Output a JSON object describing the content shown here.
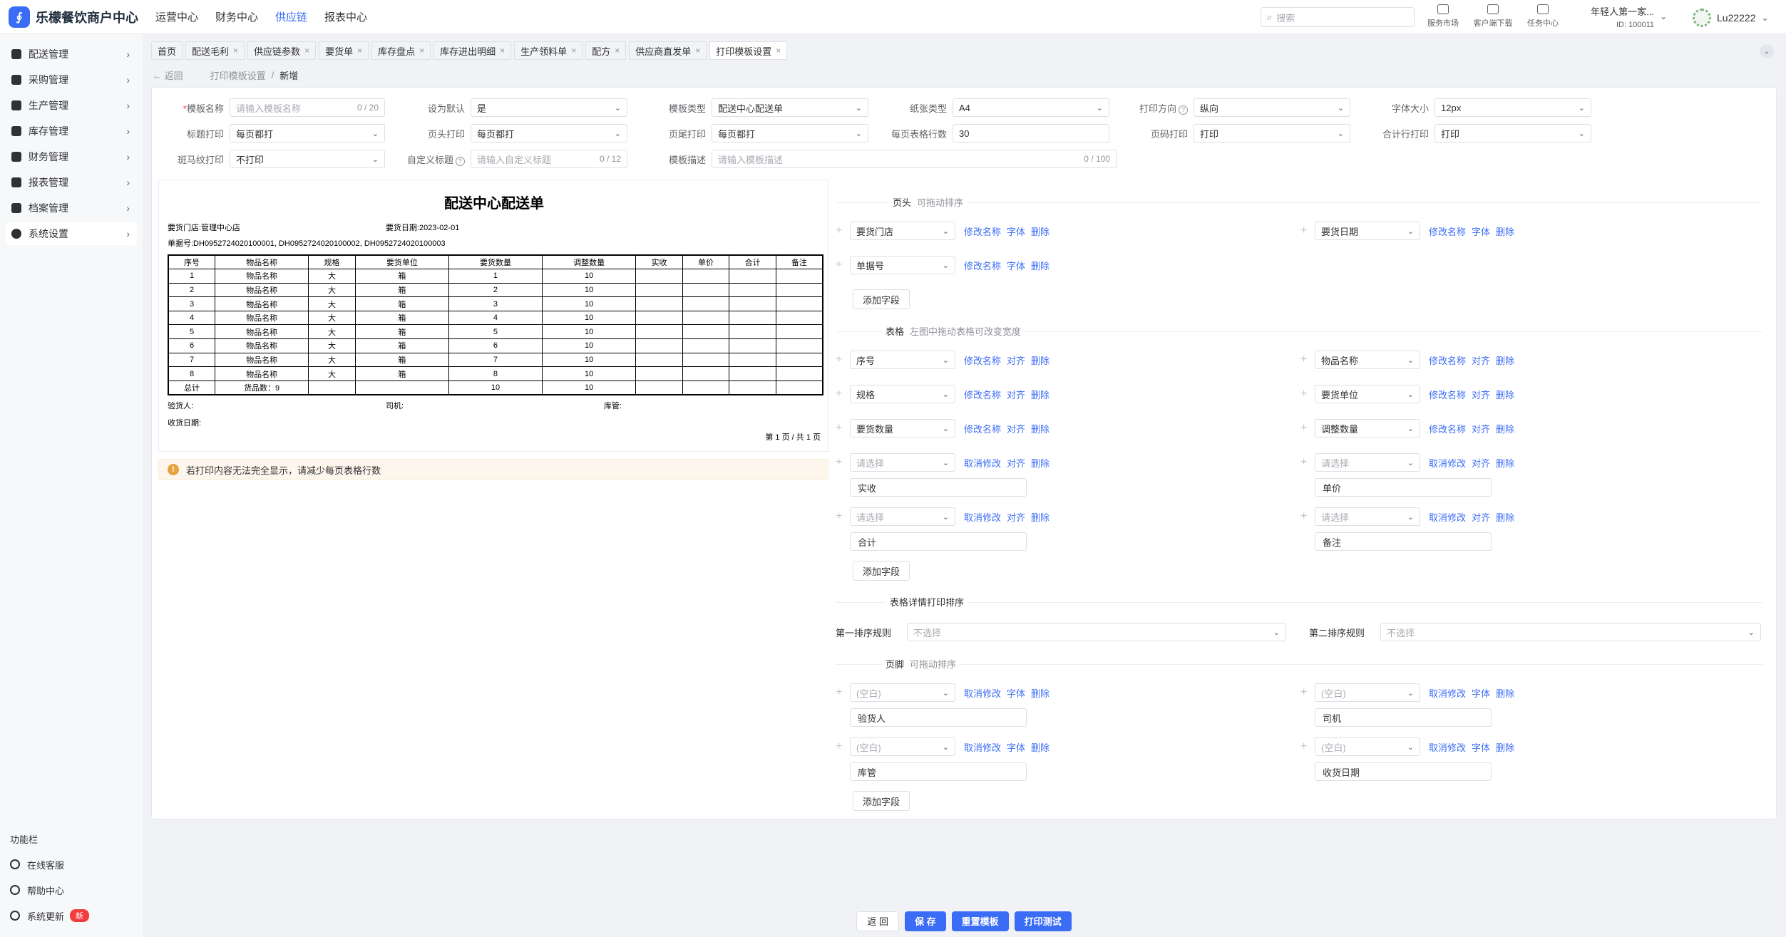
{
  "app": {
    "title": "乐檬餐饮商户中心",
    "logo_glyph": "∮"
  },
  "topnav": [
    "运营中心",
    "财务中心",
    "供应链",
    "报表中心"
  ],
  "topnav_active": "供应链",
  "search_placeholder": "搜索",
  "tools": [
    "服务市场",
    "客户端下载",
    "任务中心"
  ],
  "account": {
    "name": "年轻人第一家...",
    "id": "ID: 100011"
  },
  "user": "Lu22222",
  "sidebar": [
    "配送管理",
    "采购管理",
    "生产管理",
    "库存管理",
    "财务管理",
    "报表管理",
    "档案管理",
    "系统设置"
  ],
  "sidebar_active": "系统设置",
  "footer_title": "功能栏",
  "footer_items": [
    "在线客服",
    "帮助中心",
    "系统更新"
  ],
  "new_badge": "新",
  "tabs": [
    "首页",
    "配送毛利",
    "供应链参数",
    "要货单",
    "库存盘点",
    "库存进出明细",
    "生产领料单",
    "配方",
    "供应商直发单",
    "打印模板设置"
  ],
  "active_tab": "打印模板设置",
  "breadcrumb": {
    "back": "返回",
    "parent": "打印模板设置",
    "sep": "/",
    "current": "新增"
  },
  "form": {
    "name_label": "模板名称",
    "name_placeholder": "请输入模板名称",
    "name_count": "0 / 20",
    "default_label": "设为默认",
    "default_value": "是",
    "type_label": "模板类型",
    "type_value": "配送中心配送单",
    "paper_label": "纸张类型",
    "paper_value": "A4",
    "direction_label": "打印方向",
    "direction_value": "纵向",
    "font_label": "字体大小",
    "font_value": "12px",
    "title_print_label": "标题打印",
    "title_print_value": "每页都打",
    "header_print_label": "页头打印",
    "header_print_value": "每页都打",
    "footer_print_label": "页尾打印",
    "footer_print_value": "每页都打",
    "rows_label": "每页表格行数",
    "rows_value": "30",
    "page_no_label": "页码打印",
    "page_no_value": "打印",
    "total_label": "合计行打印",
    "total_value": "打印",
    "zebra_label": "斑马纹打印",
    "zebra_value": "不打印",
    "custom_title_label": "自定义标题",
    "custom_title_placeholder": "请输入自定义标题",
    "custom_title_count": "0 / 12",
    "desc_label": "模板描述",
    "desc_placeholder": "请输入模板描述",
    "desc_count": "0 / 100"
  },
  "preview": {
    "title": "配送中心配送单",
    "store": "要货门店:管理中心店",
    "date": "要货日期:2023-02-01",
    "orders": "单据号:DH0952724020100001, DH0952724020100002, DH0952724020100003",
    "headers": [
      "序号",
      "物品名称",
      "规格",
      "要货单位",
      "要货数量",
      "调整数量",
      "实收",
      "单价",
      "合计",
      "备注"
    ],
    "rows": [
      [
        "1",
        "物品名称",
        "大",
        "箱",
        "1",
        "10",
        "",
        "",
        "",
        ""
      ],
      [
        "2",
        "物品名称",
        "大",
        "箱",
        "2",
        "10",
        "",
        "",
        "",
        ""
      ],
      [
        "3",
        "物品名称",
        "大",
        "箱",
        "3",
        "10",
        "",
        "",
        "",
        ""
      ],
      [
        "4",
        "物品名称",
        "大",
        "箱",
        "4",
        "10",
        "",
        "",
        "",
        ""
      ],
      [
        "5",
        "物品名称",
        "大",
        "箱",
        "5",
        "10",
        "",
        "",
        "",
        ""
      ],
      [
        "6",
        "物品名称",
        "大",
        "箱",
        "6",
        "10",
        "",
        "",
        "",
        ""
      ],
      [
        "7",
        "物品名称",
        "大",
        "箱",
        "7",
        "10",
        "",
        "",
        "",
        ""
      ],
      [
        "8",
        "物品名称",
        "大",
        "箱",
        "8",
        "10",
        "",
        "",
        "",
        ""
      ]
    ],
    "total_row": [
      "总计",
      "货品数：9",
      "",
      "",
      "10",
      "10",
      "",
      "",
      "",
      ""
    ],
    "inspector": "验货人:",
    "driver": "司机:",
    "keeper": "库管:",
    "receive_date": "收货日期:",
    "page_info": "第 1 页 / 共 1 页"
  },
  "warning": "若打印内容无法完全显示，请减少每页表格行数",
  "header_section": {
    "title": "页头",
    "hint": "可拖动排序",
    "fields": [
      {
        "value": "要货门店",
        "links": [
          "修改名称",
          "字体",
          "删除"
        ]
      },
      {
        "value": "要货日期",
        "links": [
          "修改名称",
          "字体",
          "删除"
        ]
      },
      {
        "value": "单据号",
        "links": [
          "修改名称",
          "字体",
          "删除"
        ]
      }
    ]
  },
  "table_section": {
    "title": "表格",
    "hint": "左图中拖动表格可改变宽度",
    "fields": [
      {
        "value": "序号",
        "links": [
          "修改名称",
          "对齐",
          "删除"
        ]
      },
      {
        "value": "物品名称",
        "links": [
          "修改名称",
          "对齐",
          "删除"
        ]
      },
      {
        "value": "规格",
        "links": [
          "修改名称",
          "对齐",
          "删除"
        ]
      },
      {
        "value": "要货单位",
        "links": [
          "修改名称",
          "对齐",
          "删除"
        ]
      },
      {
        "value": "要货数量",
        "links": [
          "修改名称",
          "对齐",
          "删除"
        ]
      },
      {
        "value": "调整数量",
        "links": [
          "修改名称",
          "对齐",
          "删除"
        ]
      },
      {
        "value": "请选择",
        "links": [
          "取消修改",
          "对齐",
          "删除"
        ],
        "custom": "实收"
      },
      {
        "value": "请选择",
        "links": [
          "取消修改",
          "对齐",
          "删除"
        ],
        "custom": "单价"
      },
      {
        "value": "请选择",
        "links": [
          "取消修改",
          "对齐",
          "删除"
        ],
        "custom": "合计"
      },
      {
        "value": "请选择",
        "links": [
          "取消修改",
          "对齐",
          "删除"
        ],
        "custom": "备注"
      }
    ]
  },
  "sort_section": {
    "title": "表格详情打印排序",
    "first_label": "第一排序规则",
    "second_label": "第二排序规则",
    "placeholder": "不选择"
  },
  "footer_section": {
    "title": "页脚",
    "hint": "可拖动排序",
    "fields": [
      {
        "value": "(空白)",
        "links": [
          "取消修改",
          "字体",
          "删除"
        ],
        "custom": "验货人"
      },
      {
        "value": "(空白)",
        "links": [
          "取消修改",
          "字体",
          "删除"
        ],
        "custom": "司机"
      },
      {
        "value": "(空白)",
        "links": [
          "取消修改",
          "字体",
          "删除"
        ],
        "custom": "库管"
      },
      {
        "value": "(空白)",
        "links": [
          "取消修改",
          "字体",
          "删除"
        ],
        "custom": "收货日期"
      }
    ]
  },
  "add_field": "添加字段",
  "buttons": {
    "back": "返 回",
    "save": "保 存",
    "reset": "重置模板",
    "print_test": "打印测试"
  },
  "colors": {
    "primary": "#3b6cf6",
    "warning": "#e6a23c",
    "badge": "#f23d3d"
  }
}
